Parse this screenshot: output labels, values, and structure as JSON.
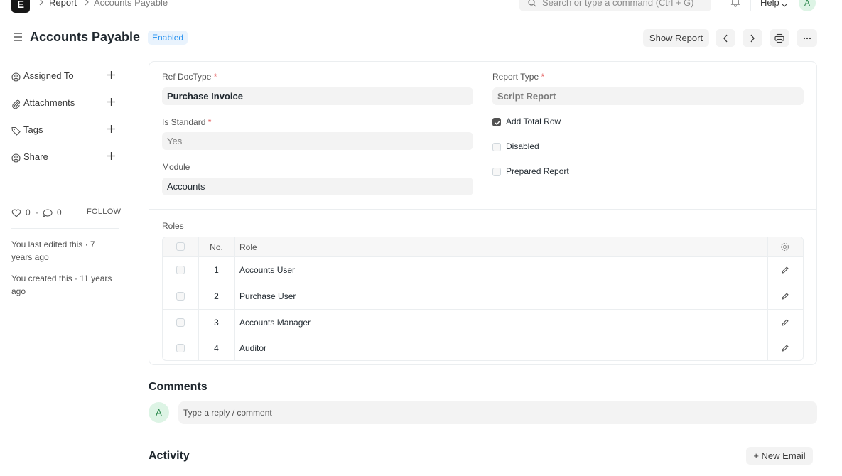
{
  "navbar": {
    "logo": "E",
    "breadcrumbs": [
      "Report",
      "Accounts Payable"
    ],
    "search_placeholder": "Search or type a command (Ctrl + G)",
    "help_label": "Help",
    "avatar_initial": "A"
  },
  "page": {
    "title": "Accounts Payable",
    "status": "Enabled",
    "show_report_label": "Show Report"
  },
  "sidebar": {
    "items": [
      {
        "label": "Assigned To",
        "icon": "assign-user-icon"
      },
      {
        "label": "Attachments",
        "icon": "paperclip-icon"
      },
      {
        "label": "Tags",
        "icon": "tag-icon"
      },
      {
        "label": "Share",
        "icon": "share-user-icon"
      }
    ],
    "likes": "0",
    "comments": "0",
    "dot": "·",
    "follow_label": "FOLLOW",
    "last_edited": "You last edited this · 7 years ago",
    "created": "You created this · 11 years ago"
  },
  "form": {
    "ref_doctype_label": "Ref DocType",
    "ref_doctype_value": "Purchase Invoice",
    "is_standard_label": "Is Standard",
    "is_standard_value": "Yes",
    "module_label": "Module",
    "module_value": "Accounts",
    "report_type_label": "Report Type",
    "report_type_value": "Script Report",
    "required_mark": "*",
    "add_total_row_label": "Add Total Row",
    "add_total_row_checked": true,
    "disabled_label": "Disabled",
    "disabled_checked": false,
    "prepared_report_label": "Prepared Report",
    "prepared_report_checked": false
  },
  "roles": {
    "label": "Roles",
    "columns": {
      "no": "No.",
      "role": "Role"
    },
    "rows": [
      {
        "no": "1",
        "role": "Accounts User"
      },
      {
        "no": "2",
        "role": "Purchase User"
      },
      {
        "no": "3",
        "role": "Accounts Manager"
      },
      {
        "no": "4",
        "role": "Auditor"
      }
    ]
  },
  "comments": {
    "title": "Comments",
    "avatar_initial": "A",
    "placeholder": "Type a reply / comment"
  },
  "activity": {
    "title": "Activity",
    "new_email_label": "+ New Email"
  },
  "colors": {
    "accent": "#2490ef",
    "badge_bg": "#e9f3fd",
    "required": "#e24c4c",
    "avatar_bg": "#ddf4e5"
  }
}
